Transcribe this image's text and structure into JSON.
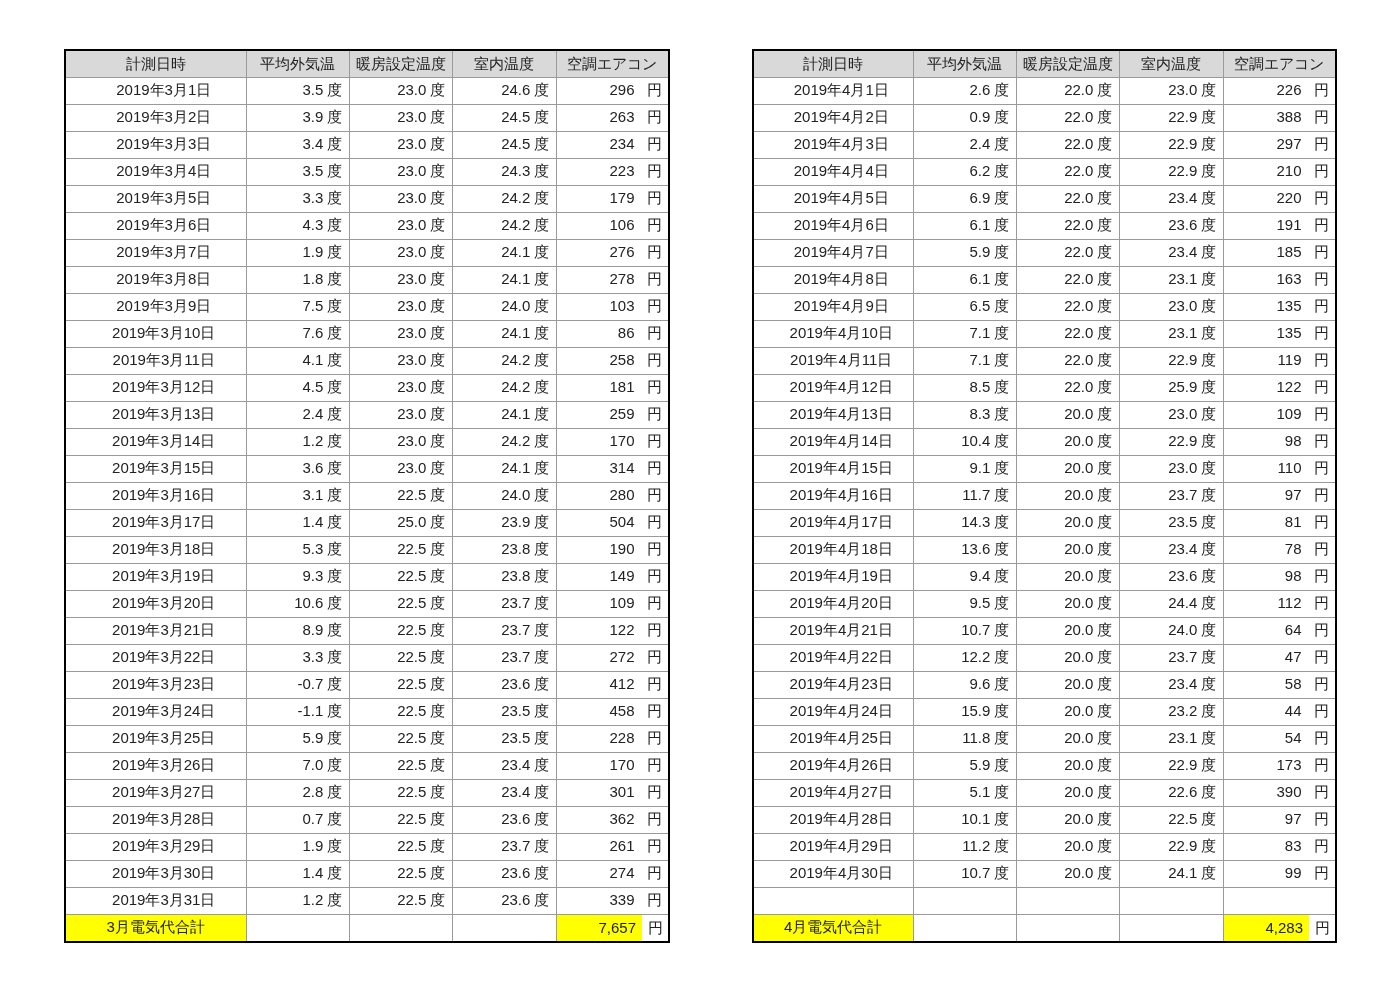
{
  "tables": [
    {
      "columns": [
        "計測日時",
        "平均外気温",
        "暖房設定温度",
        "室内温度",
        "空調エアコン"
      ],
      "rows": [
        [
          "2019年3月1日",
          "3.5 度",
          "23.0 度",
          "24.6 度",
          "296 円"
        ],
        [
          "2019年3月2日",
          "3.9 度",
          "23.0 度",
          "24.5 度",
          "263 円"
        ],
        [
          "2019年3月3日",
          "3.4 度",
          "23.0 度",
          "24.5 度",
          "234 円"
        ],
        [
          "2019年3月4日",
          "3.5 度",
          "23.0 度",
          "24.3 度",
          "223 円"
        ],
        [
          "2019年3月5日",
          "3.3 度",
          "23.0 度",
          "24.2 度",
          "179 円"
        ],
        [
          "2019年3月6日",
          "4.3 度",
          "23.0 度",
          "24.2 度",
          "106 円"
        ],
        [
          "2019年3月7日",
          "1.9 度",
          "23.0 度",
          "24.1 度",
          "276 円"
        ],
        [
          "2019年3月8日",
          "1.8 度",
          "23.0 度",
          "24.1 度",
          "278 円"
        ],
        [
          "2019年3月9日",
          "7.5 度",
          "23.0 度",
          "24.0 度",
          "103 円"
        ],
        [
          "2019年3月10日",
          "7.6 度",
          "23.0 度",
          "24.1 度",
          "86 円"
        ],
        [
          "2019年3月11日",
          "4.1 度",
          "23.0 度",
          "24.2 度",
          "258 円"
        ],
        [
          "2019年3月12日",
          "4.5 度",
          "23.0 度",
          "24.2 度",
          "181 円"
        ],
        [
          "2019年3月13日",
          "2.4 度",
          "23.0 度",
          "24.1 度",
          "259 円"
        ],
        [
          "2019年3月14日",
          "1.2 度",
          "23.0 度",
          "24.2 度",
          "170 円"
        ],
        [
          "2019年3月15日",
          "3.6 度",
          "23.0 度",
          "24.1 度",
          "314 円"
        ],
        [
          "2019年3月16日",
          "3.1 度",
          "22.5 度",
          "24.0 度",
          "280 円"
        ],
        [
          "2019年3月17日",
          "1.4 度",
          "25.0 度",
          "23.9 度",
          "504 円"
        ],
        [
          "2019年3月18日",
          "5.3 度",
          "22.5 度",
          "23.8 度",
          "190 円"
        ],
        [
          "2019年3月19日",
          "9.3 度",
          "22.5 度",
          "23.8 度",
          "149 円"
        ],
        [
          "2019年3月20日",
          "10.6 度",
          "22.5 度",
          "23.7 度",
          "109 円"
        ],
        [
          "2019年3月21日",
          "8.9 度",
          "22.5 度",
          "23.7 度",
          "122 円"
        ],
        [
          "2019年3月22日",
          "3.3 度",
          "22.5 度",
          "23.7 度",
          "272 円"
        ],
        [
          "2019年3月23日",
          "-0.7 度",
          "22.5 度",
          "23.6 度",
          "412 円"
        ],
        [
          "2019年3月24日",
          "-1.1 度",
          "22.5 度",
          "23.5 度",
          "458 円"
        ],
        [
          "2019年3月25日",
          "5.9 度",
          "22.5 度",
          "23.5 度",
          "228 円"
        ],
        [
          "2019年3月26日",
          "7.0 度",
          "22.5 度",
          "23.4 度",
          "170 円"
        ],
        [
          "2019年3月27日",
          "2.8 度",
          "22.5 度",
          "23.4 度",
          "301 円"
        ],
        [
          "2019年3月28日",
          "0.7 度",
          "22.5 度",
          "23.6 度",
          "362 円"
        ],
        [
          "2019年3月29日",
          "1.9 度",
          "22.5 度",
          "23.7 度",
          "261 円"
        ],
        [
          "2019年3月30日",
          "1.4 度",
          "22.5 度",
          "23.6 度",
          "274 円"
        ],
        [
          "2019年3月31日",
          "1.2 度",
          "22.5 度",
          "23.6 度",
          "339 円"
        ]
      ],
      "total": {
        "label": "3月電気代合計",
        "amount": "7,657",
        "unit": "円"
      }
    },
    {
      "columns": [
        "計測日時",
        "平均外気温",
        "暖房設定温度",
        "室内温度",
        "空調エアコン"
      ],
      "rows": [
        [
          "2019年4月1日",
          "2.6 度",
          "22.0 度",
          "23.0 度",
          "226 円"
        ],
        [
          "2019年4月2日",
          "0.9 度",
          "22.0 度",
          "22.9 度",
          "388 円"
        ],
        [
          "2019年4月3日",
          "2.4 度",
          "22.0 度",
          "22.9 度",
          "297 円"
        ],
        [
          "2019年4月4日",
          "6.2 度",
          "22.0 度",
          "22.9 度",
          "210 円"
        ],
        [
          "2019年4月5日",
          "6.9 度",
          "22.0 度",
          "23.4 度",
          "220 円"
        ],
        [
          "2019年4月6日",
          "6.1 度",
          "22.0 度",
          "23.6 度",
          "191 円"
        ],
        [
          "2019年4月7日",
          "5.9 度",
          "22.0 度",
          "23.4 度",
          "185 円"
        ],
        [
          "2019年4月8日",
          "6.1 度",
          "22.0 度",
          "23.1 度",
          "163 円"
        ],
        [
          "2019年4月9日",
          "6.5 度",
          "22.0 度",
          "23.0 度",
          "135 円"
        ],
        [
          "2019年4月10日",
          "7.1 度",
          "22.0 度",
          "23.1 度",
          "135 円"
        ],
        [
          "2019年4月11日",
          "7.1 度",
          "22.0 度",
          "22.9 度",
          "119 円"
        ],
        [
          "2019年4月12日",
          "8.5 度",
          "22.0 度",
          "25.9 度",
          "122 円"
        ],
        [
          "2019年4月13日",
          "8.3 度",
          "20.0 度",
          "23.0 度",
          "109 円"
        ],
        [
          "2019年4月14日",
          "10.4 度",
          "20.0 度",
          "22.9 度",
          "98 円"
        ],
        [
          "2019年4月15日",
          "9.1 度",
          "20.0 度",
          "23.0 度",
          "110 円"
        ],
        [
          "2019年4月16日",
          "11.7 度",
          "20.0 度",
          "23.7 度",
          "97 円"
        ],
        [
          "2019年4月17日",
          "14.3 度",
          "20.0 度",
          "23.5 度",
          "81 円"
        ],
        [
          "2019年4月18日",
          "13.6 度",
          "20.0 度",
          "23.4 度",
          "78 円"
        ],
        [
          "2019年4月19日",
          "9.4 度",
          "20.0 度",
          "23.6 度",
          "98 円"
        ],
        [
          "2019年4月20日",
          "9.5 度",
          "20.0 度",
          "24.4 度",
          "112 円"
        ],
        [
          "2019年4月21日",
          "10.7 度",
          "20.0 度",
          "24.0 度",
          "64 円"
        ],
        [
          "2019年4月22日",
          "12.2 度",
          "20.0 度",
          "23.7 度",
          "47 円"
        ],
        [
          "2019年4月23日",
          "9.6 度",
          "20.0 度",
          "23.4 度",
          "58 円"
        ],
        [
          "2019年4月24日",
          "15.9 度",
          "20.0 度",
          "23.2 度",
          "44 円"
        ],
        [
          "2019年4月25日",
          "11.8 度",
          "20.0 度",
          "23.1 度",
          "54 円"
        ],
        [
          "2019年4月26日",
          "5.9 度",
          "20.0 度",
          "22.9 度",
          "173 円"
        ],
        [
          "2019年4月27日",
          "5.1 度",
          "20.0 度",
          "22.6 度",
          "390 円"
        ],
        [
          "2019年4月28日",
          "10.1 度",
          "20.0 度",
          "22.5 度",
          "97 円"
        ],
        [
          "2019年4月29日",
          "11.2 度",
          "20.0 度",
          "22.9 度",
          "83 円"
        ],
        [
          "2019年4月30日",
          "10.7 度",
          "20.0 度",
          "24.1 度",
          "99 円"
        ]
      ],
      "total": {
        "label": "4月電気代合計",
        "amount": "4,283",
        "unit": "円"
      }
    }
  ]
}
